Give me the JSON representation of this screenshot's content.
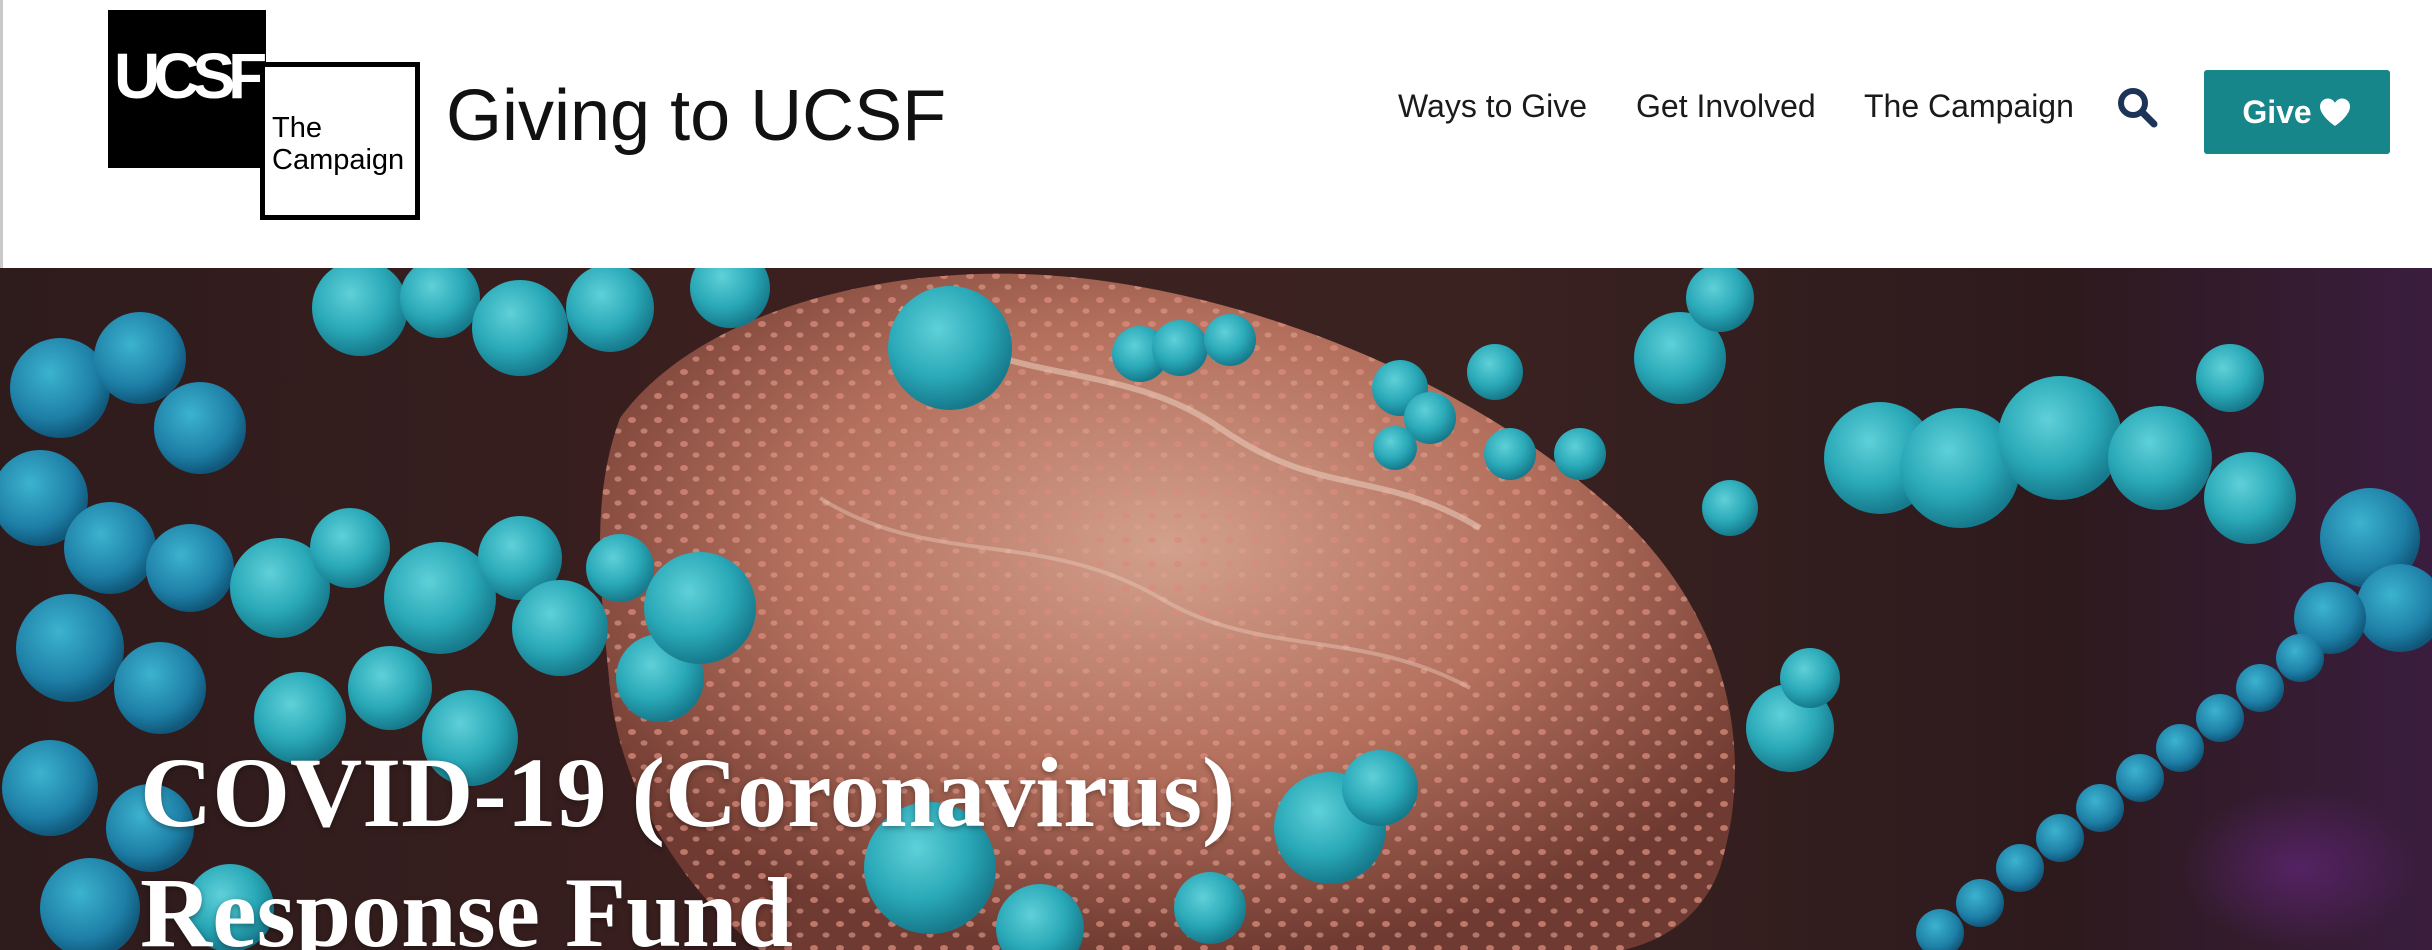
{
  "logo": {
    "mark": "UCSF",
    "line1": "The",
    "line2": "Campaign"
  },
  "site": {
    "title": "Giving to UCSF"
  },
  "nav": {
    "items": [
      {
        "label": "Ways to Give"
      },
      {
        "label": "Get Involved"
      },
      {
        "label": "The Campaign"
      }
    ],
    "search_icon": "search-icon",
    "give_label": "Give",
    "give_icon": "heart-icon"
  },
  "hero": {
    "title_line1": "COVID-19 (Coronavirus)",
    "title_line2": "Response Fund"
  },
  "colors": {
    "accent": "#16868a",
    "search_icon": "#1c3458",
    "text": "#1a1a1a"
  }
}
